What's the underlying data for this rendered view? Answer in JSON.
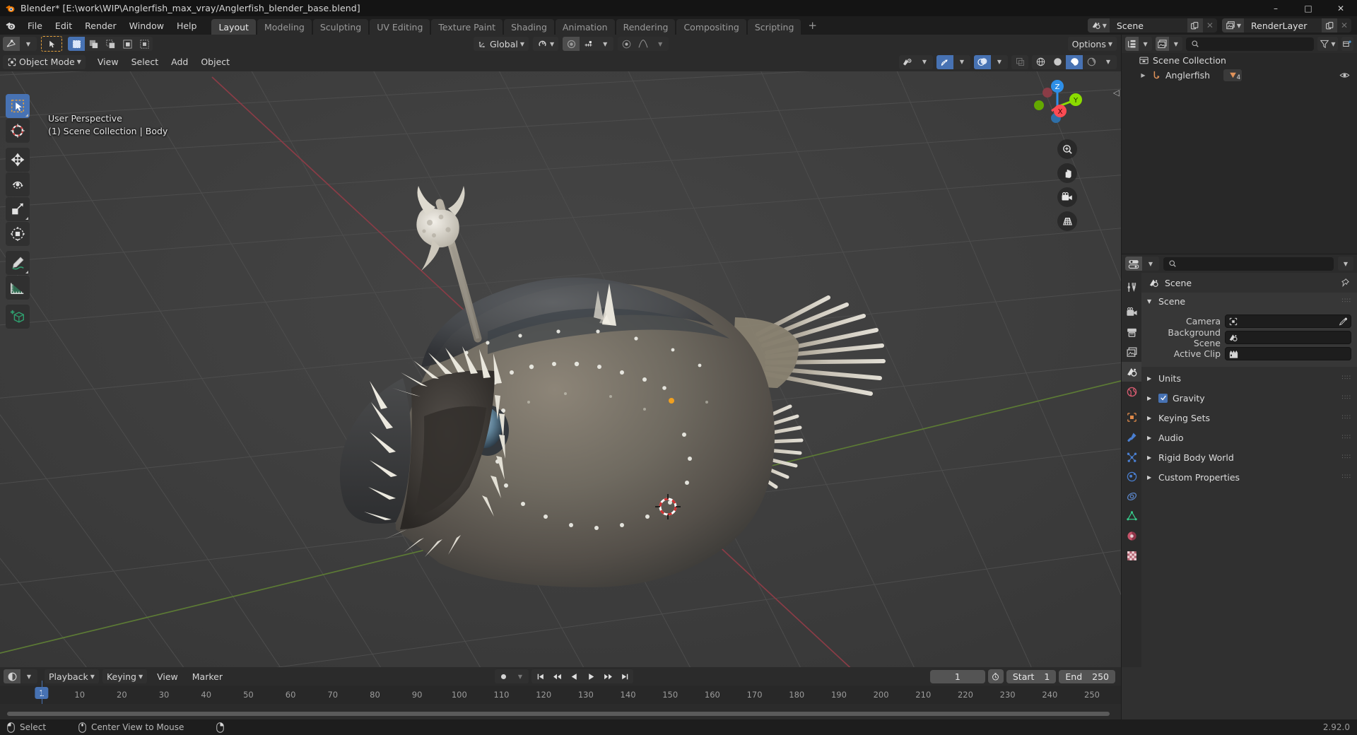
{
  "window": {
    "title": "Blender* [E:\\work\\WIP\\Anglerfish_max_vray/Anglerfish_blender_base.blend]",
    "minimize": "–",
    "maximize": "□",
    "close": "✕"
  },
  "menu": {
    "items": [
      "File",
      "Edit",
      "Render",
      "Window",
      "Help"
    ]
  },
  "workspaces": {
    "tabs": [
      "Layout",
      "Modeling",
      "Sculpting",
      "UV Editing",
      "Texture Paint",
      "Shading",
      "Animation",
      "Rendering",
      "Compositing",
      "Scripting"
    ],
    "active": "Layout",
    "add_label": "+"
  },
  "topbar_ids": {
    "scene_name": "Scene",
    "viewlayer_name": "RenderLayer"
  },
  "viewport": {
    "header": {
      "mode": "Object Mode",
      "menus": [
        "View",
        "Select",
        "Add",
        "Object"
      ],
      "transform_orientation": "Global",
      "options_label": "Options"
    },
    "overlay_text_line1": "User Perspective",
    "overlay_text_line2": "(1) Scene Collection | Body",
    "gizmo_axes": [
      "X",
      "Y",
      "Z"
    ],
    "axis_colors": {
      "x": "#fc4b53",
      "y": "#8bdc00",
      "z": "#2e8fe8"
    },
    "background": "#3b3b3b",
    "grid_line": "#4a4a4a"
  },
  "toolbar": {
    "tools": [
      {
        "name": "tweak-select-box",
        "label": "Select Box"
      },
      {
        "name": "cursor",
        "label": "Cursor"
      },
      {
        "name": "move",
        "label": "Move"
      },
      {
        "name": "rotate",
        "label": "Rotate"
      },
      {
        "name": "scale",
        "label": "Scale"
      },
      {
        "name": "transform",
        "label": "Transform"
      },
      {
        "name": "annotate",
        "label": "Annotate"
      },
      {
        "name": "measure",
        "label": "Measure"
      },
      {
        "name": "add-cube",
        "label": "Add Cube"
      }
    ],
    "active_index": 0
  },
  "outliner": {
    "search_placeholder": "",
    "rows": [
      {
        "label": "Scene Collection",
        "icon": "collection-icon",
        "indent": 0,
        "badge": null
      },
      {
        "label": "Anglerfish",
        "icon": "armature-icon",
        "indent": 1,
        "badge": "4"
      }
    ]
  },
  "properties": {
    "search_placeholder": "",
    "breadcrumb": "Scene",
    "tabs": [
      "tool-icon",
      "render-icon",
      "output-icon",
      "view-layer-icon",
      "scene-icon",
      "world-icon",
      "object-icon",
      "modifier-icon",
      "particles-icon",
      "physics-icon",
      "constraint-icon",
      "data-icon",
      "material-icon",
      "texture-icon"
    ],
    "active_tab": 4,
    "panels": [
      {
        "title": "Scene",
        "open": true,
        "checkbox": null
      },
      {
        "title": "Units",
        "open": false,
        "checkbox": null
      },
      {
        "title": "Gravity",
        "open": false,
        "checkbox": true
      },
      {
        "title": "Keying Sets",
        "open": false,
        "checkbox": null
      },
      {
        "title": "Audio",
        "open": false,
        "checkbox": null
      },
      {
        "title": "Rigid Body World",
        "open": false,
        "checkbox": null
      },
      {
        "title": "Custom Properties",
        "open": false,
        "checkbox": null
      }
    ],
    "scene_fields": [
      {
        "label": "Camera",
        "value": "",
        "icon": "camera-data-icon",
        "eyedropper": true
      },
      {
        "label": "Background Scene",
        "value": "",
        "icon": "scene-icon",
        "eyedropper": false
      },
      {
        "label": "Active Clip",
        "value": "",
        "icon": "clip-icon",
        "eyedropper": false
      }
    ]
  },
  "timeline": {
    "menus": [
      "Playback",
      "Keying",
      "View",
      "Marker"
    ],
    "current_frame": "1",
    "start_label": "Start",
    "start_value": "1",
    "end_label": "End",
    "end_value": "250",
    "ticks": [
      "10",
      "20",
      "30",
      "40",
      "50",
      "60",
      "70",
      "80",
      "90",
      "100",
      "110",
      "120",
      "130",
      "140",
      "150",
      "160",
      "170",
      "180",
      "190",
      "200",
      "210",
      "220",
      "230",
      "240",
      "250"
    ],
    "playhead_label": "1"
  },
  "statusbar": {
    "hints": [
      {
        "icon": "mouse-left-icon",
        "label": "Select"
      },
      {
        "icon": "mouse-middle-icon",
        "label": "Center View to Mouse"
      },
      {
        "icon": "mouse-right-icon",
        "label": ""
      }
    ],
    "version": "2.92.0"
  }
}
